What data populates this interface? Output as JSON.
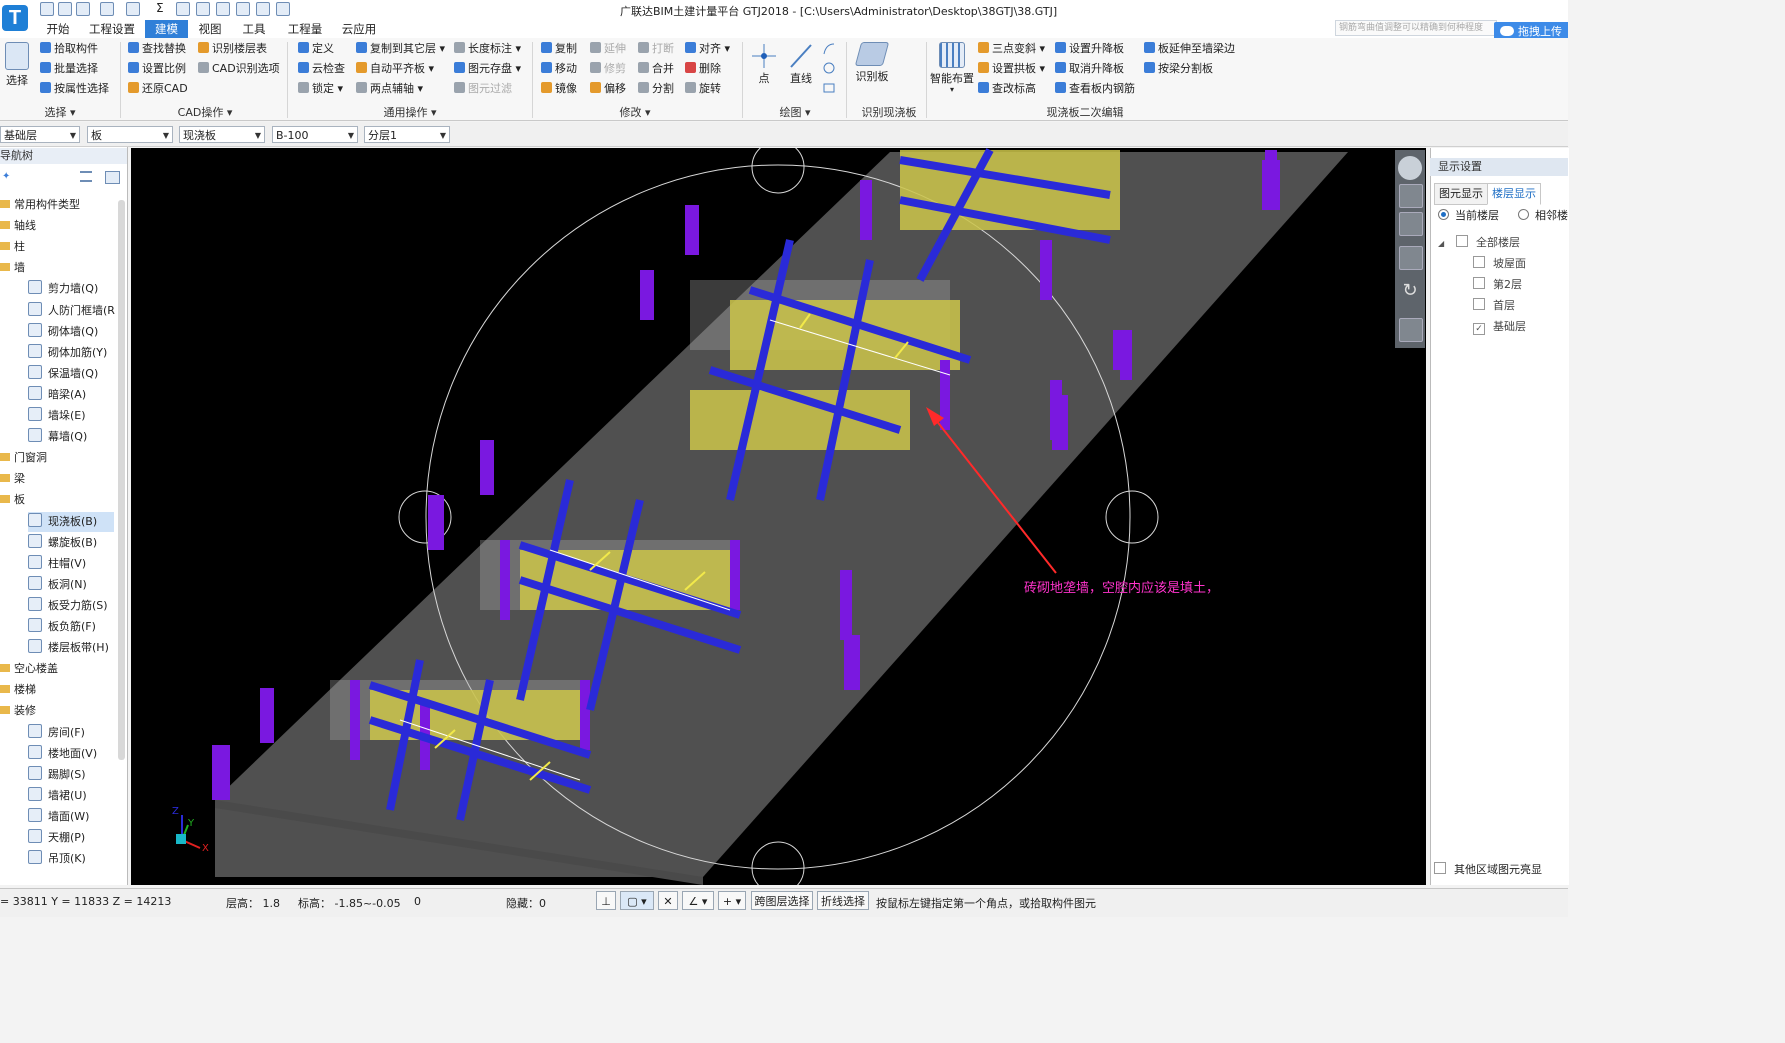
{
  "window": {
    "title": "广联达BIM土建计量平台 GTJ2018 - [C:\\Users\\Administrator\\Desktop\\38GTJ\\38.GTJ]",
    "search_placeholder": "钢筋弯曲值调整可以精确到何种程度",
    "login_label": "拖拽上传"
  },
  "tabs": [
    "开始",
    "工程设置",
    "建模",
    "视图",
    "工具",
    "工程量",
    "云应用"
  ],
  "active_tab": "建模",
  "ribbon": {
    "select_group": {
      "big": "选择",
      "items": [
        "拾取构件",
        "批量选择",
        "按属性选择"
      ],
      "label": "选择"
    },
    "cad_group": {
      "items": [
        "查找替换",
        "识别楼层表",
        "设置比例",
        "CAD识别选项",
        "还原CAD"
      ],
      "label": "CAD操作"
    },
    "common_group": {
      "items": [
        "定义",
        "复制到其它层",
        "长度标注",
        "云检查",
        "自动平齐板",
        "图元存盘",
        "锁定",
        "两点辅轴",
        "图元过滤"
      ],
      "label": "通用操作"
    },
    "modify_group": {
      "items": [
        "复制",
        "延伸",
        "打断",
        "对齐",
        "移动",
        "修剪",
        "合并",
        "删除",
        "镜像",
        "偏移",
        "分割",
        "旋转"
      ],
      "label": "修改"
    },
    "draw_group": {
      "items": [
        "点",
        "直线"
      ],
      "label": "绘图"
    },
    "recog_group": {
      "items": [
        "识别板"
      ],
      "label": "识别现浇板"
    },
    "edit2_group": {
      "big": "智能布置",
      "items": [
        "三点变斜",
        "设置升降板",
        "板延伸至墙梁边",
        "设置拱板",
        "取消升降板",
        "按梁分割板",
        "查改标高",
        "查看板内钢筋"
      ],
      "label": "现浇板二次编辑"
    }
  },
  "filters": [
    "基础层",
    "板",
    "现浇板",
    "B-100",
    "分层1"
  ],
  "nav": {
    "title": "导航树",
    "items": [
      {
        "label": "常用构件类型",
        "level": 0
      },
      {
        "label": "轴线",
        "level": 0
      },
      {
        "label": "柱",
        "level": 0
      },
      {
        "label": "墙",
        "level": 0
      },
      {
        "label": "剪力墙(Q)",
        "level": 1
      },
      {
        "label": "人防门框墙(R",
        "level": 1
      },
      {
        "label": "砌体墙(Q)",
        "level": 1
      },
      {
        "label": "砌体加筋(Y)",
        "level": 1
      },
      {
        "label": "保温墙(Q)",
        "level": 1
      },
      {
        "label": "暗梁(A)",
        "level": 1
      },
      {
        "label": "墙垛(E)",
        "level": 1
      },
      {
        "label": "幕墙(Q)",
        "level": 1
      },
      {
        "label": "门窗洞",
        "level": 0
      },
      {
        "label": "梁",
        "level": 0
      },
      {
        "label": "板",
        "level": 0
      },
      {
        "label": "现浇板(B)",
        "level": 1,
        "selected": true
      },
      {
        "label": "螺旋板(B)",
        "level": 1
      },
      {
        "label": "柱帽(V)",
        "level": 1
      },
      {
        "label": "板洞(N)",
        "level": 1
      },
      {
        "label": "板受力筋(S)",
        "level": 1
      },
      {
        "label": "板负筋(F)",
        "level": 1
      },
      {
        "label": "楼层板带(H)",
        "level": 1
      },
      {
        "label": "空心楼盖",
        "level": 0
      },
      {
        "label": "楼梯",
        "level": 0
      },
      {
        "label": "装修",
        "level": 0
      },
      {
        "label": "房间(F)",
        "level": 1
      },
      {
        "label": "楼地面(V)",
        "level": 1
      },
      {
        "label": "踢脚(S)",
        "level": 1
      },
      {
        "label": "墙裙(U)",
        "level": 1
      },
      {
        "label": "墙面(W)",
        "level": 1
      },
      {
        "label": "天棚(P)",
        "level": 1
      },
      {
        "label": "吊顶(K)",
        "level": 1
      }
    ]
  },
  "viewport": {
    "annotation": "砖砌地垄墙，空腔内应该是填土，",
    "axis_labels": {
      "z": "Z",
      "y": "Y",
      "x": "X"
    }
  },
  "display_panel": {
    "title": "显示设置",
    "tabs": [
      "图元显示",
      "楼层显示"
    ],
    "active_tab": "楼层显示",
    "radios": [
      "当前楼层",
      "相邻楼"
    ],
    "floors": [
      {
        "label": "全部楼层",
        "checked": false
      },
      {
        "label": "坡屋面",
        "checked": false
      },
      {
        "label": "第2层",
        "checked": false
      },
      {
        "label": "首层",
        "checked": false
      },
      {
        "label": "基础层",
        "checked": true
      }
    ],
    "other_highlight": "其他区域图元亮显"
  },
  "status": {
    "coords": "= 33811 Y = 11833 Z = 14213",
    "floor_height": "层高： 1.8",
    "elevation": "标高： -1.85~-0.05",
    "zero": "0",
    "hidden": "隐藏：0",
    "cross_layer": "跨图层选择",
    "polyline": "折线选择",
    "hint": "按鼠标左键指定第一个角点，或拾取构件图元"
  },
  "colors": {
    "accent": "#2f7fd8",
    "annotation": "#ff33cc",
    "wall_yellow": "#c8c24a",
    "beam_blue": "#2a2ad8",
    "column_purple": "#7a18e0"
  }
}
